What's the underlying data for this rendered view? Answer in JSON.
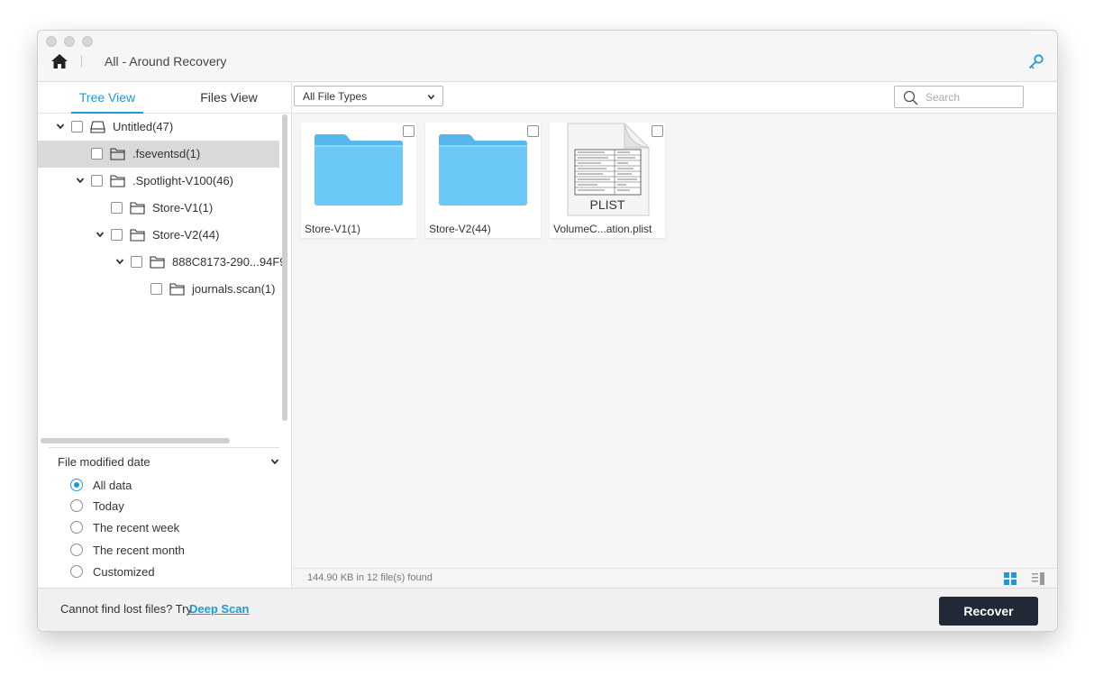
{
  "colors": {
    "accent": "#1e9ad6",
    "recover_button": "#212836",
    "folder_blue": "#6cc8f7",
    "selected_row": "#d9d9d9"
  },
  "header": {
    "title": "All - Around Recovery",
    "home_icon": "home-icon",
    "key_icon": "key-icon"
  },
  "left_panel": {
    "tabs": [
      {
        "label": "Tree View",
        "active": true
      },
      {
        "label": "Files View",
        "active": false
      }
    ],
    "tree": [
      {
        "label": "Untitled(47)",
        "icon": "drive-icon",
        "expanded": true,
        "level": 0
      },
      {
        "label": ".fseventsd(1)",
        "icon": "folder-icon",
        "selected": true,
        "level": 1
      },
      {
        "label": ".Spotlight-V100(46)",
        "icon": "folder-icon",
        "expanded": true,
        "level": 1
      },
      {
        "label": "Store-V1(1)",
        "icon": "folder-icon",
        "level": 2
      },
      {
        "label": "Store-V2(44)",
        "icon": "folder-icon",
        "expanded": true,
        "level": 2
      },
      {
        "label": "888C8173-290...94F9",
        "icon": "folder-icon",
        "expanded": true,
        "level": 3
      },
      {
        "label": "journals.scan(1)",
        "icon": "folder-icon",
        "level": 4
      }
    ],
    "filter": {
      "title": "File modified date",
      "options": [
        {
          "label": "All data",
          "selected": true
        },
        {
          "label": "Today",
          "selected": false
        },
        {
          "label": "The recent week",
          "selected": false
        },
        {
          "label": "The recent month",
          "selected": false
        },
        {
          "label": "Customized",
          "selected": false
        }
      ]
    }
  },
  "toolbar": {
    "file_type": "All File Types",
    "search_placeholder": "Search"
  },
  "files": [
    {
      "name": "Store-V1(1)",
      "type": "folder"
    },
    {
      "name": "Store-V2(44)",
      "type": "folder"
    },
    {
      "name": "VolumeC...ation.plist",
      "type": "plist",
      "thumb_label": "PLIST"
    }
  ],
  "status": {
    "text": "144.90 KB in 12 file(s) found"
  },
  "footer": {
    "prompt": "Cannot find lost files? Try",
    "deep_scan": "Deep Scan",
    "recover": "Recover"
  }
}
